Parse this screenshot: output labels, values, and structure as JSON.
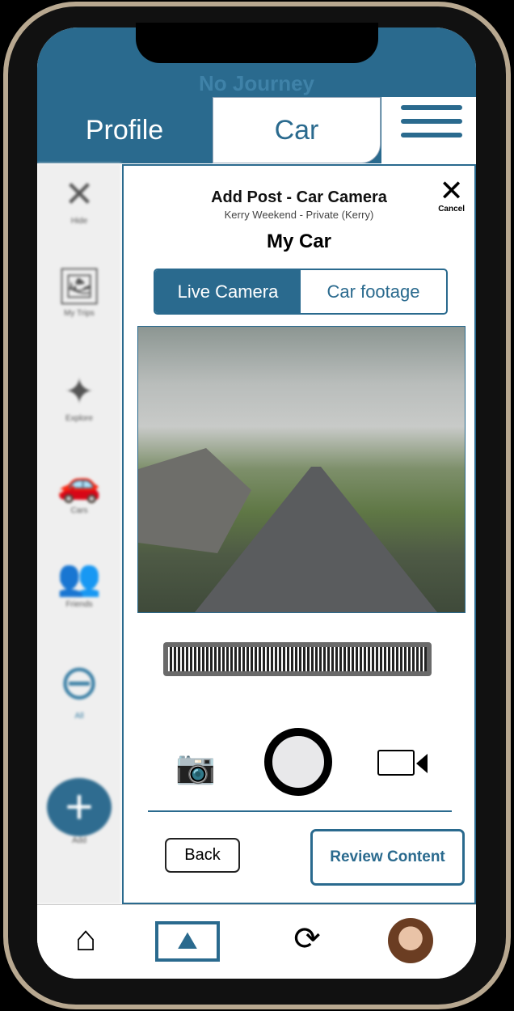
{
  "header": {
    "app_title": "No Journey",
    "tab_profile": "Profile",
    "tab_car": "Car"
  },
  "sidebar": {
    "items": [
      {
        "label": "Hide",
        "icon": "close-icon"
      },
      {
        "label": "My Trips",
        "icon": "image-icon"
      },
      {
        "label": "Explore",
        "icon": "compass-icon"
      },
      {
        "label": "Cars",
        "icon": "car-icon"
      },
      {
        "label": "Friends",
        "icon": "friends-icon"
      },
      {
        "label": "All",
        "icon": "infinity-icon"
      },
      {
        "label": "Add",
        "icon": "plus-icon"
      }
    ]
  },
  "panel": {
    "title": "Add Post - Car Camera",
    "subtitle": "Kerry Weekend - Private (Kerry)",
    "car_name": "My Car",
    "cancel": "Cancel",
    "seg_live": "Live Camera",
    "seg_footage": "Car footage",
    "back": "Back",
    "review": "Review Content"
  },
  "colors": {
    "accent": "#2a6a8e"
  }
}
